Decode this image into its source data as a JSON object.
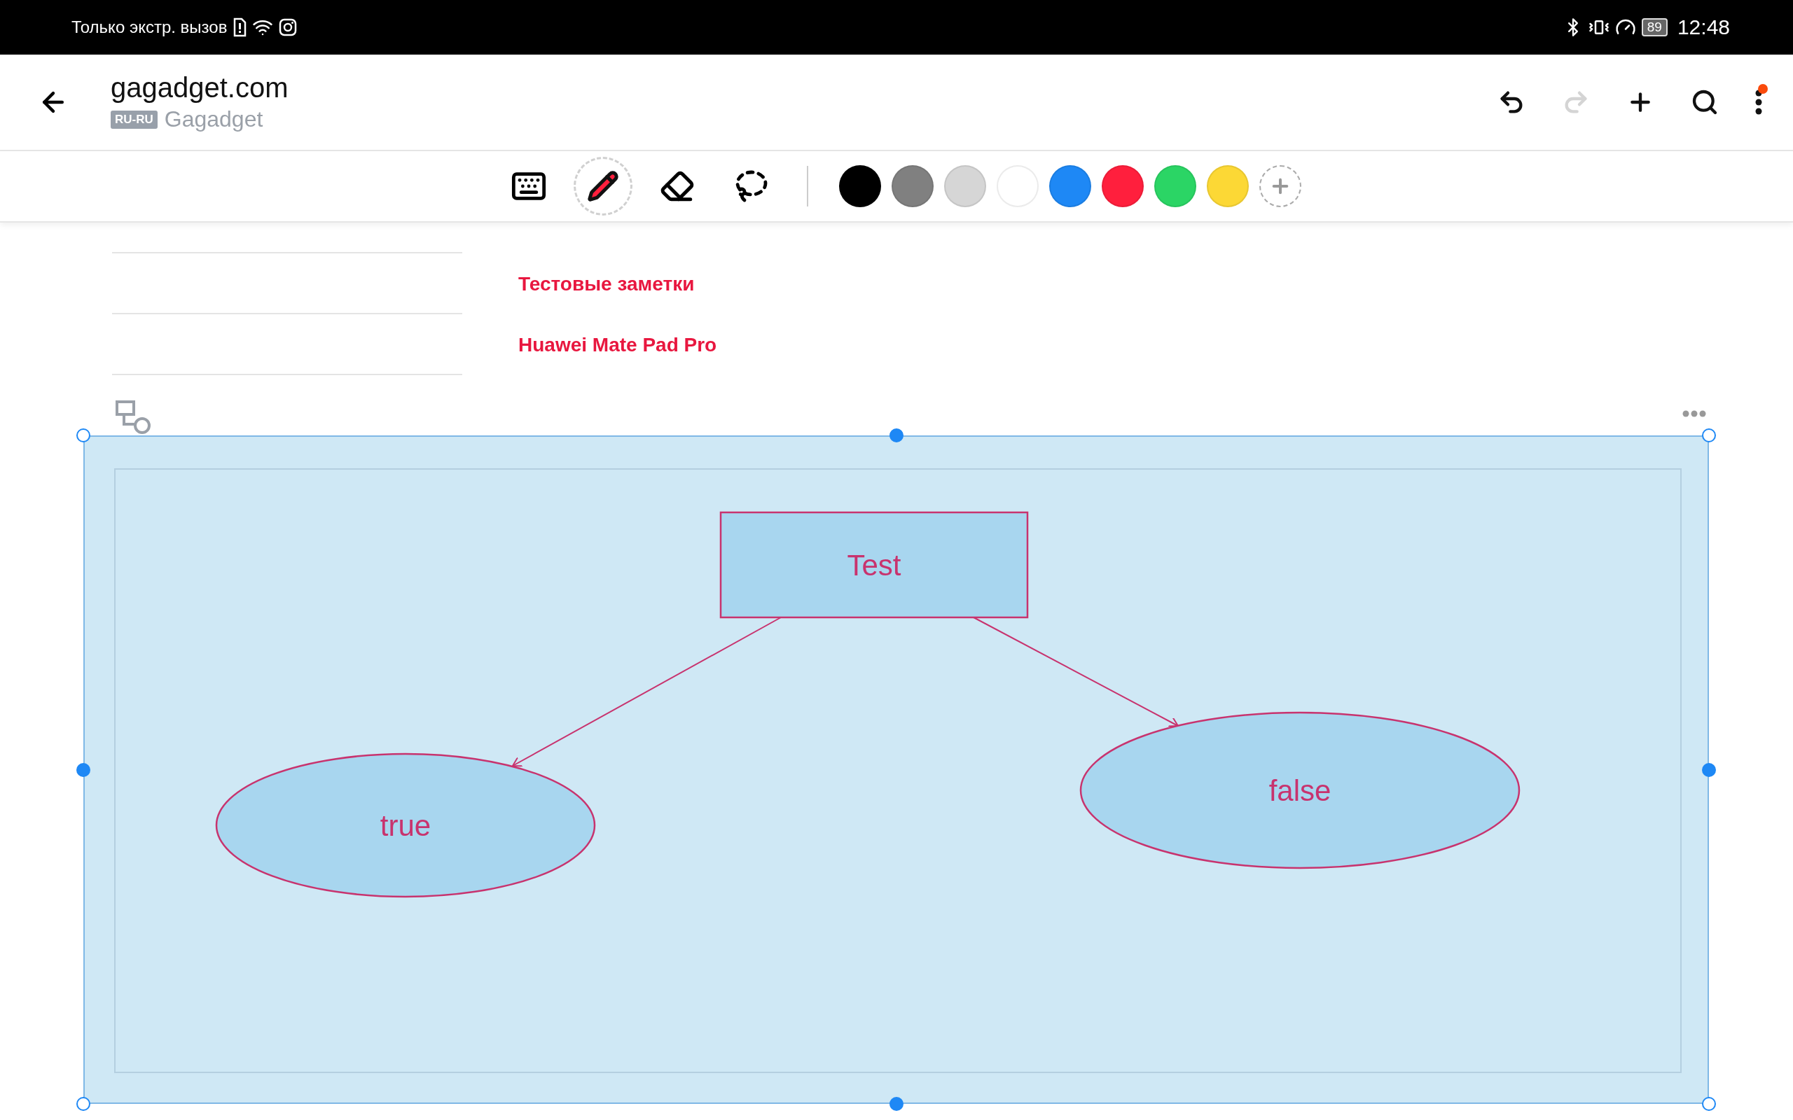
{
  "status_bar": {
    "carrier": "Только экстр. вызов",
    "battery": "89",
    "time": "12:48"
  },
  "header": {
    "title": "gagadget.com",
    "badge": "RU-RU",
    "subtitle": "Gagadget",
    "actions": [
      {
        "kind": "undo",
        "disabled": false
      },
      {
        "kind": "redo",
        "disabled": true
      },
      {
        "kind": "add",
        "disabled": false
      },
      {
        "kind": "search",
        "disabled": false
      },
      {
        "kind": "more",
        "disabled": false,
        "notification": true
      }
    ]
  },
  "toolbar": {
    "tools": [
      {
        "kind": "keyboard",
        "selected": false
      },
      {
        "kind": "pen",
        "selected": true
      },
      {
        "kind": "eraser",
        "selected": false
      },
      {
        "kind": "lasso",
        "selected": false
      }
    ],
    "colors": [
      {
        "color": "#000000"
      },
      {
        "color": "#808080"
      },
      {
        "color": "#d6d6d6"
      },
      {
        "color": "#ffffff"
      },
      {
        "color": "#1e88f5"
      },
      {
        "color": "#ff1f3d"
      },
      {
        "color": "#2bd565"
      },
      {
        "color": "#fcd835"
      }
    ]
  },
  "notes": [
    {
      "title": "Тестовые заметки"
    },
    {
      "title": "Huawei Mate Pad Pro"
    }
  ],
  "diagram": {
    "selected": true,
    "nodes": [
      {
        "kind": "rect",
        "label": "Test"
      },
      {
        "kind": "ellipse",
        "label": "true"
      },
      {
        "kind": "ellipse",
        "label": "false"
      }
    ],
    "edges": [
      {
        "kind": "arrow"
      },
      {
        "kind": "arrow"
      }
    ]
  }
}
